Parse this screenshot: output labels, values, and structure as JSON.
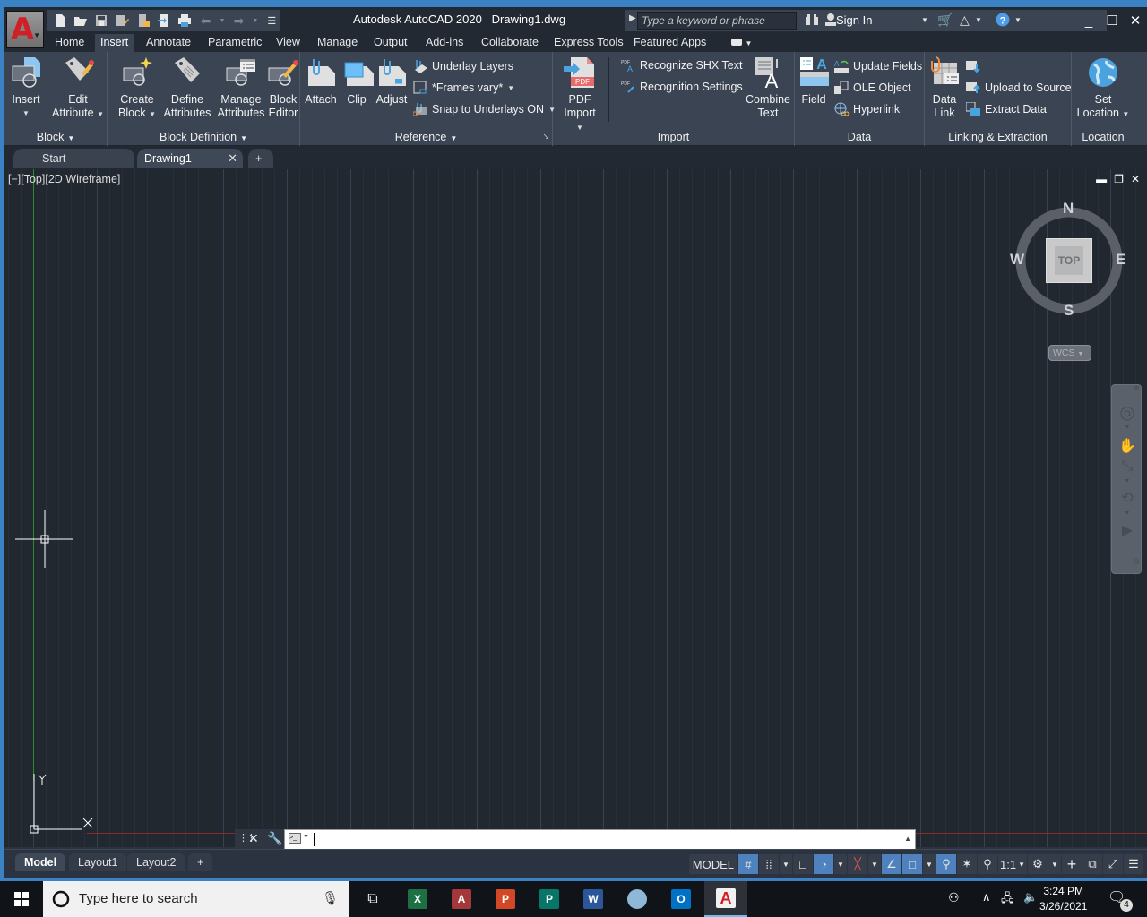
{
  "app": {
    "title": "Autodesk AutoCAD 2020",
    "document": "Drawing1.dwg",
    "logo_letter": "A",
    "accent_color": "#d11f26"
  },
  "quick_access": {
    "icons": [
      "new-icon",
      "open-icon",
      "save-icon",
      "save-as-icon",
      "open-from-web-icon",
      "save-to-web-icon",
      "plot-icon",
      "undo-icon",
      "redo-icon",
      "customize-icon"
    ]
  },
  "search": {
    "placeholder": "Type a keyword or phrase",
    "sign_in": "Sign In"
  },
  "ribbon_tabs": [
    {
      "label": "Home"
    },
    {
      "label": "Insert",
      "active": true
    },
    {
      "label": "Annotate"
    },
    {
      "label": "Parametric"
    },
    {
      "label": "View"
    },
    {
      "label": "Manage"
    },
    {
      "label": "Output"
    },
    {
      "label": "Add-ins"
    },
    {
      "label": "Collaborate"
    },
    {
      "label": "Express Tools"
    },
    {
      "label": "Featured Apps"
    }
  ],
  "ribbon": {
    "block": {
      "label": "Block",
      "insert": "Insert",
      "edit_attribute_1": "Edit",
      "edit_attribute_2": "Attribute"
    },
    "block_definition": {
      "label": "Block Definition",
      "create_1": "Create",
      "create_2": "Block",
      "define_1": "Define",
      "define_2": "Attributes",
      "manage_1": "Manage",
      "manage_2": "Attributes",
      "editor_1": "Block",
      "editor_2": "Editor"
    },
    "reference": {
      "label": "Reference",
      "attach": "Attach",
      "clip": "Clip",
      "adjust": "Adjust",
      "underlay_layers": "Underlay Layers",
      "frames": "*Frames vary*",
      "snap": "Snap to Underlays ON"
    },
    "import": {
      "label": "Import",
      "pdf_1": "PDF",
      "pdf_2": "Import",
      "recognize_shx": "Recognize SHX Text",
      "recognition_settings": "Recognition Settings",
      "combine_1": "Combine",
      "combine_2": "Text"
    },
    "data": {
      "label": "Data",
      "field": "Field",
      "update_fields": "Update Fields",
      "ole_object": "OLE Object",
      "hyperlink": "Hyperlink"
    },
    "linking": {
      "label": "Linking & Extraction",
      "data_link_1": "Data",
      "data_link_2": "Link",
      "upload": "Upload to Source",
      "extract": "Extract  Data"
    },
    "location": {
      "label": "Location",
      "set_1": "Set",
      "set_2": "Location"
    }
  },
  "file_tabs": [
    {
      "label": "Start"
    },
    {
      "label": "Drawing1",
      "active": true
    }
  ],
  "viewport": {
    "label": "[−][Top][2D Wireframe]",
    "viewcube": {
      "n": "N",
      "s": "S",
      "e": "E",
      "w": "W",
      "face": "TOP"
    },
    "ucs_menu": "WCS",
    "axis_y": "Y",
    "axis_x": "X"
  },
  "command_line": {
    "value": ""
  },
  "layout_tabs": [
    {
      "label": "Model",
      "active": true
    },
    {
      "label": "Layout1"
    },
    {
      "label": "Layout2"
    }
  ],
  "status_bar": {
    "model": "MODEL",
    "scale": "1:1",
    "toggles": [
      {
        "name": "grid",
        "on": true
      },
      {
        "name": "snap",
        "on": false
      },
      {
        "name": "ortho",
        "on": false
      },
      {
        "name": "polar",
        "on": true
      },
      {
        "name": "isodraft",
        "on": false
      },
      {
        "name": "osnap-tracking",
        "on": true
      },
      {
        "name": "osnap",
        "on": true
      },
      {
        "name": "annotation-visibility",
        "on": true
      }
    ]
  },
  "taskbar": {
    "search_placeholder": "Type here to search",
    "time": "3:24 PM",
    "date": "3/26/2021",
    "notifications": "4",
    "apps": [
      {
        "name": "excel",
        "letter": "X",
        "color": "#1d7044"
      },
      {
        "name": "access",
        "letter": "A",
        "color": "#a4373a"
      },
      {
        "name": "powerpoint",
        "letter": "P",
        "color": "#d24726"
      },
      {
        "name": "publisher",
        "letter": "P",
        "color": "#077568"
      },
      {
        "name": "word",
        "letter": "W",
        "color": "#2b579a"
      },
      {
        "name": "paint",
        "letter": "",
        "color": "#8fb8d8"
      },
      {
        "name": "outlook",
        "letter": "O",
        "color": "#0072c6"
      },
      {
        "name": "autocad",
        "letter": "A",
        "color": "#d11f26"
      }
    ]
  }
}
